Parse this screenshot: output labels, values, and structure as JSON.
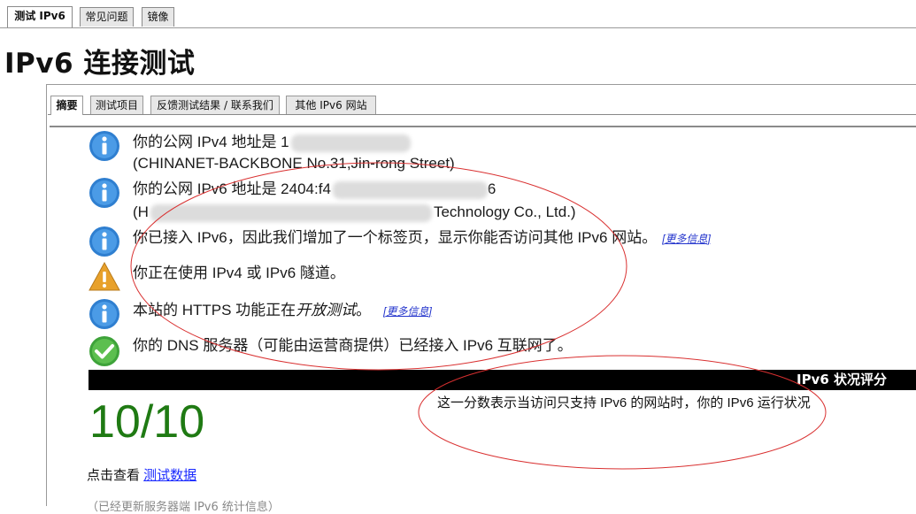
{
  "top_tabs": [
    {
      "label": "测试 IPv6",
      "active": true
    },
    {
      "label": "常见问题",
      "active": false
    },
    {
      "label": "镜像",
      "active": false
    }
  ],
  "page_title": "IPv6 连接测试",
  "sub_tabs": [
    {
      "label": "摘要",
      "active": true
    },
    {
      "label": "测试项目",
      "active": false
    },
    {
      "label": "反馈测试结果 / 联系我们",
      "active": false
    },
    {
      "label": "其他 IPv6 网站",
      "active": false
    }
  ],
  "results": [
    {
      "icon": "info-icon",
      "line1": "你的公网 IPv4 地址是 1",
      "line2": "(CHINANET-BACKBONE No.31,Jin-rong Street)"
    },
    {
      "icon": "info-icon",
      "line1": "你的公网 IPv6 地址是 2404:f4",
      "line1_tail": "6",
      "line2_head": "(H",
      "line2_tail": "Technology Co., Ltd.)"
    },
    {
      "icon": "info-icon",
      "line1": "你已接入 IPv6，因此我们增加了一个标签页，显示你能否访问其他 IPv6 网站。",
      "more": "[更多信息]"
    },
    {
      "icon": "warning-icon",
      "line1": "你正在使用 IPv4 或 IPv6 隧道。"
    },
    {
      "icon": "info-icon",
      "line1_pre": "本站的 HTTPS 功能正在",
      "line1_em": "开放测试",
      "line1_post": "。",
      "more": "[更多信息]"
    },
    {
      "icon": "check-icon",
      "line1": "你的 DNS 服务器（可能由运营商提供）已经接入 IPv6 互联网了。"
    }
  ],
  "score": {
    "bar_label": "IPv6 状况评分",
    "value": "10/10",
    "description": "这一分数表示当访问只支持 IPv6 的网站时，你的 IPv6 运行状况"
  },
  "data_link": {
    "prefix": "点击查看 ",
    "link_text": "测试数据"
  },
  "footer_cut": "（已经更新服务器端 IPv6 统计信息）",
  "colors": {
    "info_blue": "#2f7fd0",
    "warning_orange": "#e8a12b",
    "check_green": "#3ea33a",
    "score_green": "#1f7a13",
    "annotation_red": "#d93030",
    "link_blue": "#1a2aff"
  }
}
